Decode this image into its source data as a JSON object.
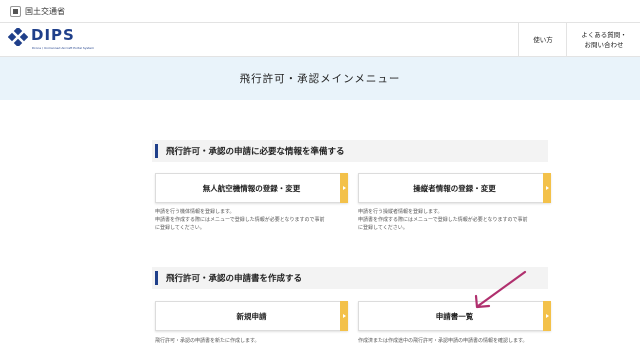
{
  "agency": {
    "name": "国土交通省"
  },
  "header": {
    "logo_text": "DIPS",
    "logo_sub": "Drone / Unmanned Aircraft Portal System",
    "nav": [
      {
        "label_lines": [
          "使い方"
        ]
      },
      {
        "label_lines": [
          "よくある質問・",
          "お問い合わせ"
        ]
      }
    ]
  },
  "hero": {
    "title": "飛行許可・承認メインメニュー"
  },
  "sections": [
    {
      "title": "飛行許可・承認の申請に必要な情報を準備する",
      "cards": [
        {
          "label": "無人航空機情報の登録・変更",
          "desc": [
            "申請を行う機体情報を登録します。",
            "申請書を作成する際にはメニューで登録した情報が必要となりますので事前",
            "に登録してください。"
          ]
        },
        {
          "label": "操縦者情報の登録・変更",
          "desc": [
            "申請を行う操縦者情報を登録します。",
            "申請書を作成する際にはメニューで登録した情報が必要となりますので事前",
            "に登録してください。"
          ]
        }
      ]
    },
    {
      "title": "飛行許可・承認の申請書を作成する",
      "cards": [
        {
          "label": "新規申請",
          "desc": [
            "飛行許可・承認の申請書を新たに作成します。"
          ]
        },
        {
          "label": "申請書一覧",
          "desc": [
            "作成済または作成途中の飛行許可・承認申請の申請書の情報を確認します。"
          ]
        }
      ]
    }
  ],
  "colors": {
    "brand": "#1f3f8a",
    "hero_bg": "#e9f3fa",
    "card_tab": "#f3c14a",
    "annotation_arrow": "#b0306e"
  },
  "icons": {
    "agency": "government-mark-icon",
    "logo": "dips-logo-icon",
    "card": "chevron-right-icon",
    "annotation": "pointer-arrow-icon"
  }
}
